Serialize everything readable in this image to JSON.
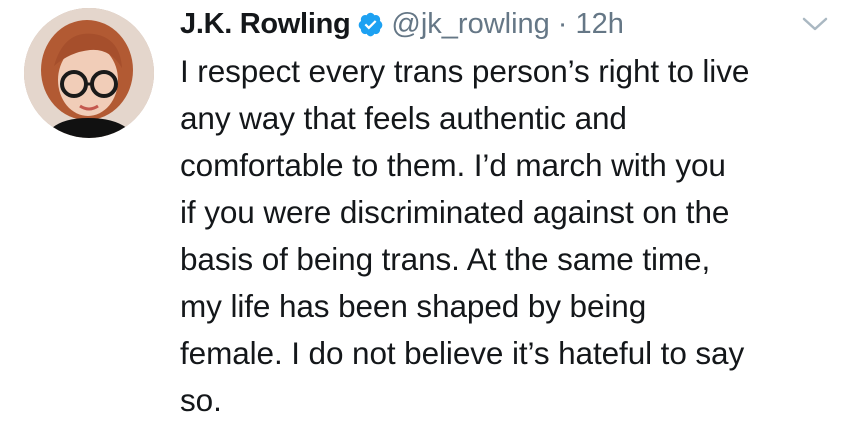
{
  "author": {
    "display_name": "J.K. Rowling",
    "handle": "@jk_rowling",
    "separator": "·",
    "timestamp": "12h",
    "verified": true
  },
  "tweet": {
    "lines": [
      "I respect every trans person’s right to live",
      "any way that feels authentic and",
      "comfortable to them. I’d march with you",
      "if you were discriminated against on the",
      "basis of being trans. At the same time,",
      "my life has been shaped by being",
      "female. I do not believe it’s hateful to say",
      "so."
    ]
  },
  "colors": {
    "verified_blue": "#1da1f2",
    "secondary_text": "#657786",
    "primary_text": "#14171a"
  },
  "icons": {
    "verified": "verified-badge-icon",
    "menu": "chevron-down-icon"
  }
}
